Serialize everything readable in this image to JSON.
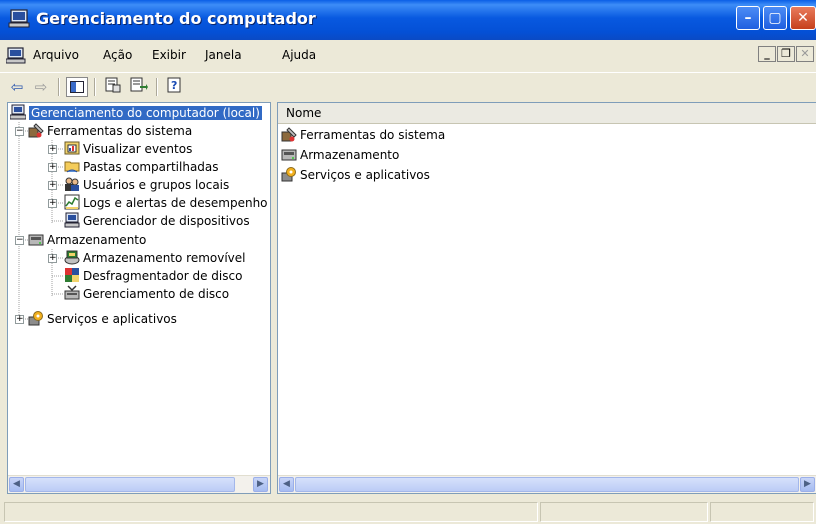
{
  "window": {
    "title": "Gerenciamento do computador",
    "icon": "computer-management-icon",
    "accent": "#0A5EE6"
  },
  "title_buttons": {
    "minimize": "minimize-icon",
    "maximize": "maximize-icon",
    "close": "close-icon"
  },
  "menu": {
    "items": [
      "Arquivo",
      "Ação",
      "Exibir",
      "Janela",
      "Ajuda"
    ]
  },
  "toolbar": {
    "buttons": [
      "back-arrow-icon",
      "forward-arrow-icon",
      "show-hide-tree-icon",
      "properties-icon",
      "export-list-icon",
      "help-icon"
    ]
  },
  "tree": {
    "root": "Gerenciamento do computador (local)",
    "items": [
      {
        "label": "Ferramentas do sistema",
        "icon": "system-tools-icon"
      },
      {
        "label": "Visualizar eventos",
        "icon": "event-viewer-icon"
      },
      {
        "label": "Pastas compartilhadas",
        "icon": "shared-folders-icon"
      },
      {
        "label": "Usuários e grupos locais",
        "icon": "users-groups-icon"
      },
      {
        "label": "Logs e alertas de desempenho",
        "icon": "performance-logs-icon"
      },
      {
        "label": "Gerenciador de dispositivos",
        "icon": "device-manager-icon"
      },
      {
        "label": "Armazenamento",
        "icon": "storage-icon"
      },
      {
        "label": "Armazenamento removível",
        "icon": "removable-storage-icon"
      },
      {
        "label": "Desfragmentador de disco",
        "icon": "defragmenter-icon"
      },
      {
        "label": "Gerenciamento de disco",
        "icon": "disk-management-icon"
      },
      {
        "label": "Serviços e aplicativos",
        "icon": "services-apps-icon"
      }
    ]
  },
  "list": {
    "column": "Nome",
    "items": [
      "Ferramentas do sistema",
      "Armazenamento",
      "Serviços e aplicativos"
    ]
  }
}
